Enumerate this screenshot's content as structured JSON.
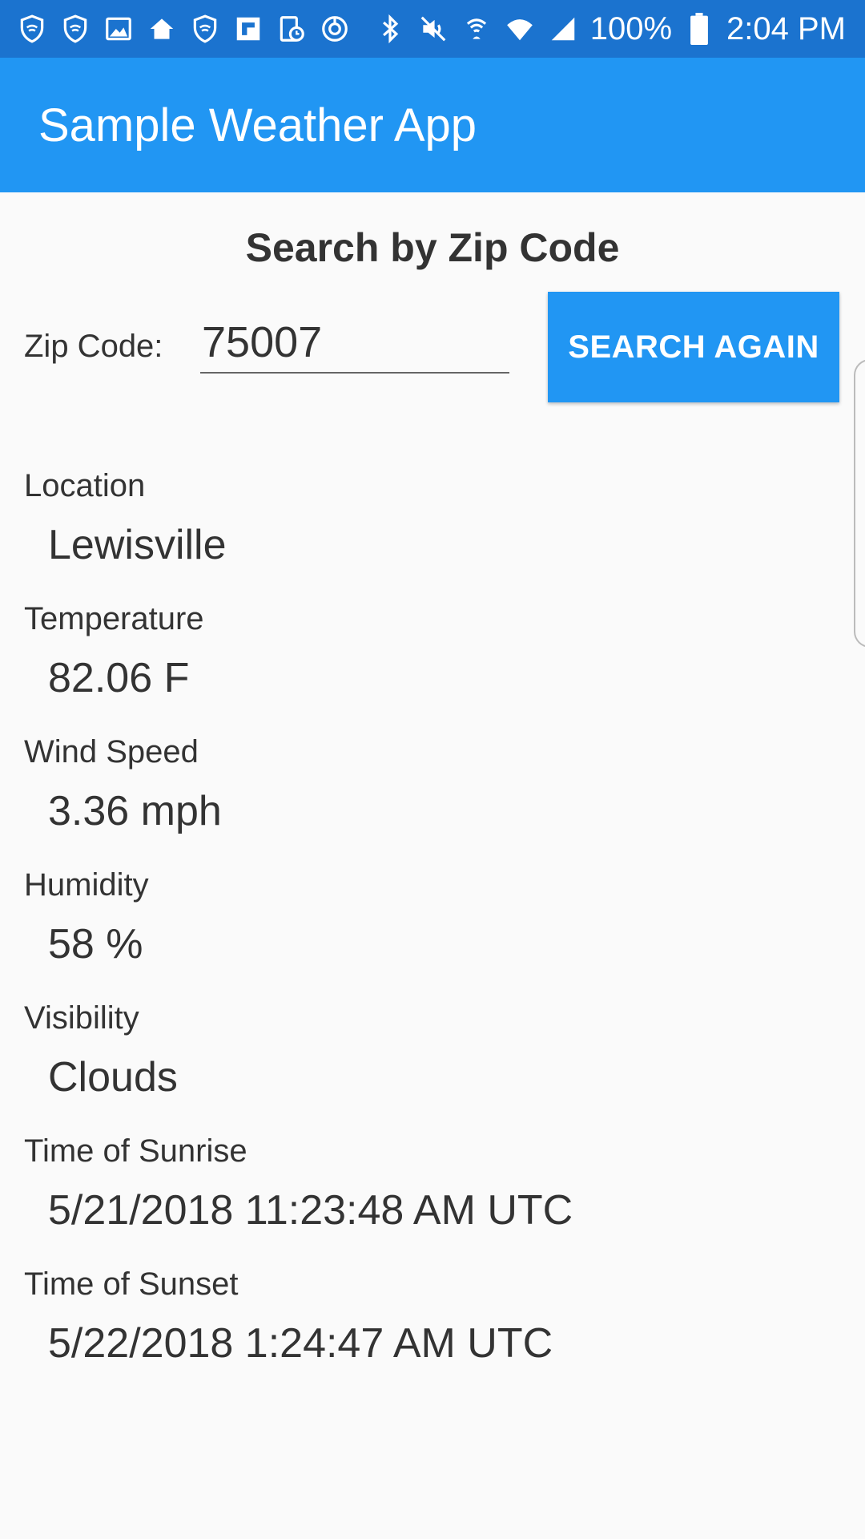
{
  "status_bar": {
    "left_icons": [
      "shield-icon",
      "shield-icon",
      "image-icon",
      "home-icon",
      "shield-icon",
      "flipboard-icon",
      "tablet-clock-icon",
      "sync-icon"
    ],
    "right_icons": [
      "bluetooth-icon",
      "mute-icon",
      "hotspot-icon",
      "wifi-icon",
      "signal-icon"
    ],
    "battery": "100%",
    "time": "2:04 PM"
  },
  "app_bar": {
    "title": "Sample Weather App"
  },
  "search": {
    "title": "Search by Zip Code",
    "zip_label": "Zip Code:",
    "zip_value": "75007",
    "button_label": "SEARCH AGAIN"
  },
  "weather": {
    "location": {
      "label": "Location",
      "value": "Lewisville"
    },
    "temperature": {
      "label": "Temperature",
      "value": "82.06 F"
    },
    "wind_speed": {
      "label": "Wind Speed",
      "value": "3.36 mph"
    },
    "humidity": {
      "label": "Humidity",
      "value": "58 %"
    },
    "visibility": {
      "label": "Visibility",
      "value": "Clouds"
    },
    "sunrise": {
      "label": "Time of Sunrise",
      "value": "5/21/2018 11:23:48 AM UTC"
    },
    "sunset": {
      "label": "Time of Sunset",
      "value": "5/22/2018 1:24:47 AM UTC"
    }
  },
  "colors": {
    "status_bar": "#1b73cf",
    "app_bar": "#2196f3",
    "button": "#2196f3",
    "background": "#fafafa",
    "text": "#333333"
  }
}
